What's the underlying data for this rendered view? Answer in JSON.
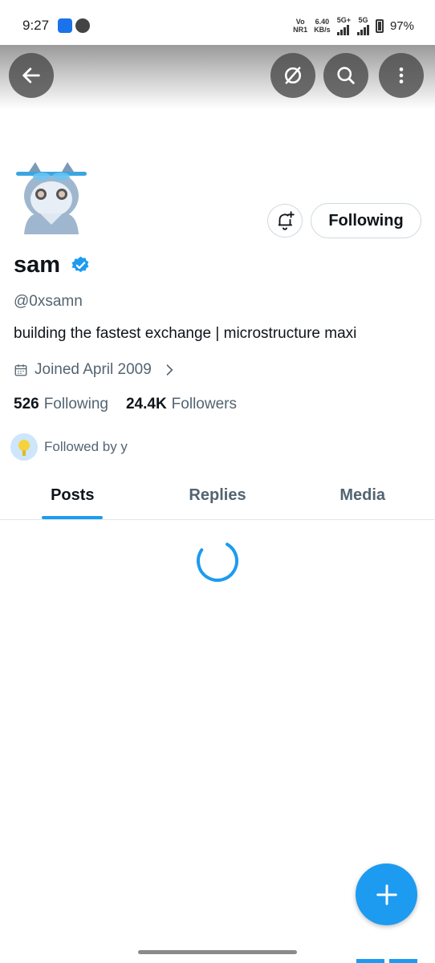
{
  "status_bar": {
    "time": "9:27",
    "carrier_top": "Vo",
    "carrier_bottom": "NR1",
    "speed_top": "6.40",
    "speed_bottom": "KB/s",
    "net1": "5G+",
    "net2": "5G",
    "battery": "97%"
  },
  "header": {
    "back_icon": "arrow-left-icon",
    "grok_icon": "slash-circle-icon",
    "search_icon": "search-icon",
    "more_icon": "more-vertical-icon"
  },
  "profile": {
    "name": "sam",
    "handle": "@0xsamn",
    "bio": "building the fastest exchange | microstructure maxi",
    "joined": "Joined April 2009",
    "following_count": "526",
    "following_label": "Following",
    "followers_count": "24.4K",
    "followers_label": "Followers",
    "followed_by": "Followed by y",
    "follow_button": "Following"
  },
  "tabs": [
    {
      "label": "Posts",
      "active": true
    },
    {
      "label": "Replies",
      "active": false
    },
    {
      "label": "Media",
      "active": false
    }
  ],
  "colors": {
    "accent": "#1d9bf0",
    "text": "#0f1419",
    "secondary": "#536471"
  }
}
